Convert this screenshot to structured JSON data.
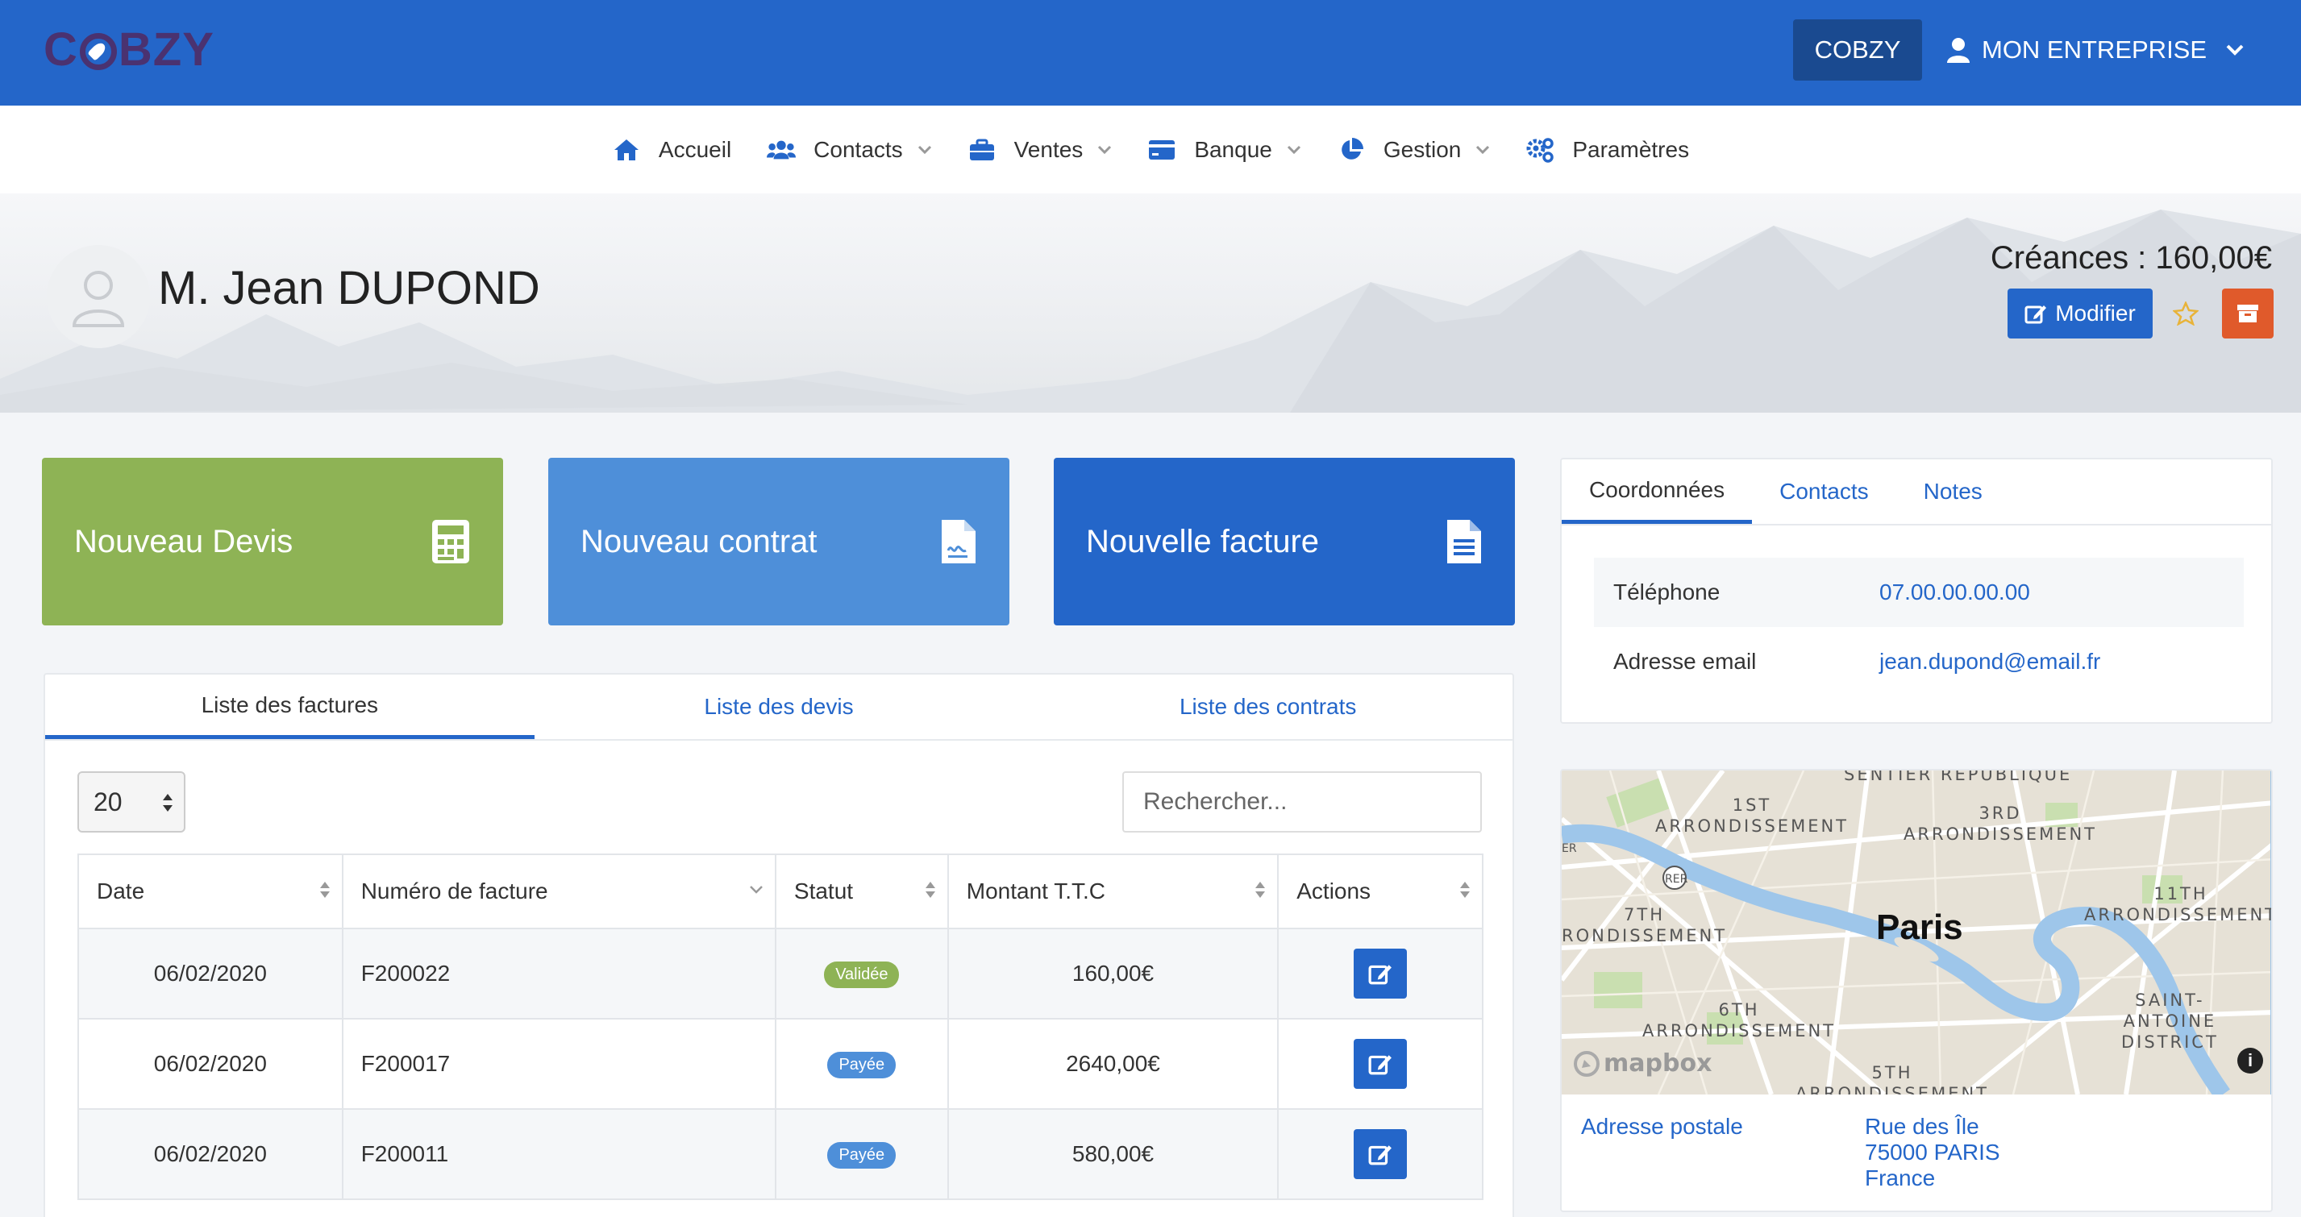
{
  "brand": {
    "logo_text_left": "C",
    "logo_text_right": "BZY"
  },
  "topbar": {
    "company_button": "COBZY",
    "user_menu_label": "MON ENTREPRISE"
  },
  "nav": [
    {
      "label": "Accueil",
      "icon": "home-icon"
    },
    {
      "label": "Contacts",
      "icon": "users-icon"
    },
    {
      "label": "Ventes",
      "icon": "briefcase-icon"
    },
    {
      "label": "Banque",
      "icon": "credit-card-icon"
    },
    {
      "label": "Gestion",
      "icon": "pie-chart-icon"
    },
    {
      "label": "Paramètres",
      "icon": "gears-icon"
    }
  ],
  "contact": {
    "name": "M. Jean DUPOND",
    "creances": "Créances : 160,00€",
    "modify_label": "Modifier"
  },
  "actions": {
    "new_quote": "Nouveau Devis",
    "new_contract": "Nouveau contrat",
    "new_invoice": "Nouvelle facture"
  },
  "list_tabs": [
    "Liste des factures",
    "Liste des devis",
    "Liste des contrats"
  ],
  "table": {
    "page_size": "20",
    "search_placeholder": "Rechercher...",
    "headers": [
      "Date",
      "Numéro de facture",
      "Statut",
      "Montant T.T.C",
      "Actions"
    ],
    "rows": [
      {
        "date": "06/02/2020",
        "number": "F200022",
        "status": "Validée",
        "amount": "160,00€"
      },
      {
        "date": "06/02/2020",
        "number": "F200017",
        "status": "Payée",
        "amount": "2640,00€"
      },
      {
        "date": "06/02/2020",
        "number": "F200011",
        "status": "Payée",
        "amount": "580,00€"
      }
    ]
  },
  "side_tabs": [
    "Coordonnées",
    "Contacts",
    "Notes"
  ],
  "coords": [
    {
      "label": "Téléphone",
      "value": "07.00.00.00.00"
    },
    {
      "label": "Adresse email",
      "value": "jean.dupond@email.fr"
    }
  ],
  "map": {
    "city": "Paris",
    "labels": {
      "top": "SENTIER  RÉPUBLIQUE",
      "a1": "1ST\nARRONDISSEMENT",
      "a3": "3RD\nARRONDISSEMENT",
      "a7": "7TH\nRONDISSEMENT",
      "a11": "11TH\nARRONDISSEMENT",
      "a6": "6TH\nARRONDISSEMENT",
      "saint": "SAINT-\nANTOINE\nDISTRICT",
      "a5": "5TH\nARRONDISSEMENT",
      "rer": "RER",
      "er": "ER"
    },
    "attribution": "mapbox"
  },
  "address": {
    "label": "Adresse postale",
    "line1": "Rue des Île",
    "line2": "75000 PARIS",
    "line3": "France"
  }
}
